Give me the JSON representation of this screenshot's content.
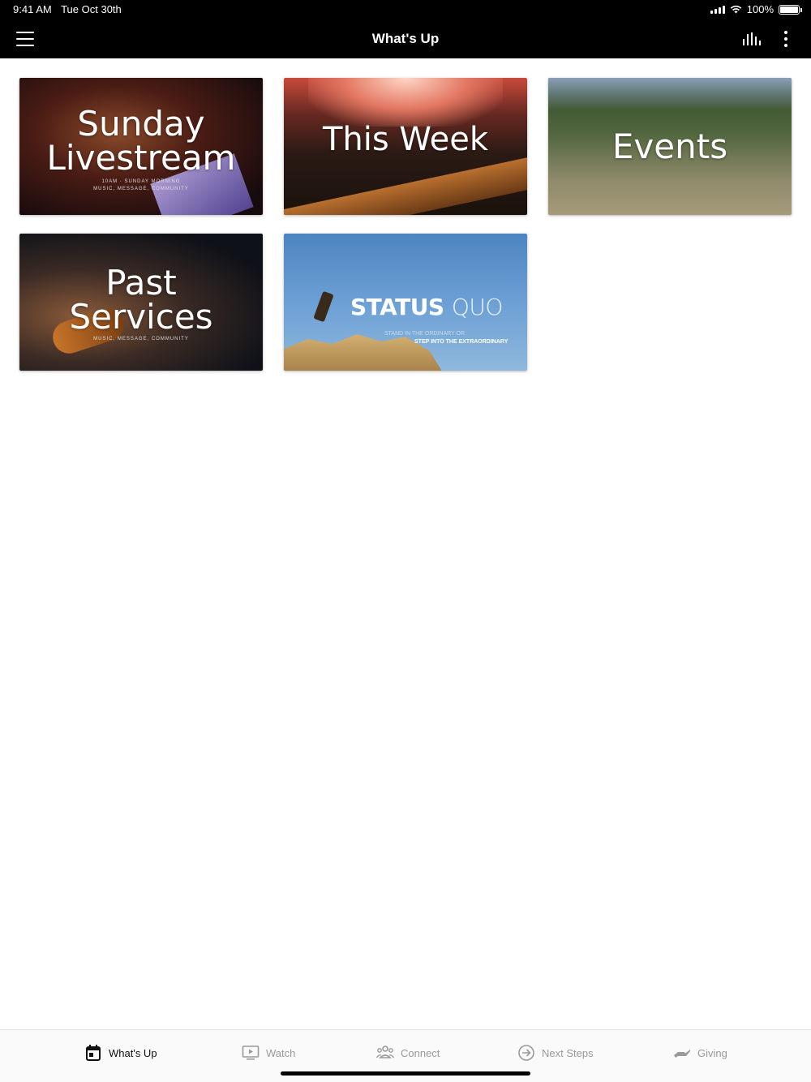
{
  "status_bar": {
    "time": "9:41 AM",
    "date": "Tue Oct 30th",
    "battery": "100%",
    "battery_level": 1.0
  },
  "header": {
    "title": "What's Up"
  },
  "tiles": [
    {
      "title_line1": "Sunday",
      "title_line2": "Livestream",
      "subtitle_line1": "10AM · SUNDAY MORNING",
      "subtitle_line2": "MUSIC, MESSAGE, COMMUNITY"
    },
    {
      "title": "This Week"
    },
    {
      "title": "Events"
    },
    {
      "title_line1": "Past",
      "title_line2": "Services",
      "subtitle": "MUSIC, MESSAGE, COMMUNITY"
    },
    {
      "title_bold": "STATUS",
      "title_light": "QUO",
      "line1": "STAND IN THE ORDINARY OR",
      "line2": "STEP INTO THE EXTRAORDINARY"
    }
  ],
  "tab_bar": {
    "tabs": [
      {
        "label": "What's Up",
        "icon": "calendar-icon",
        "active": true
      },
      {
        "label": "Watch",
        "icon": "tv-play-icon",
        "active": false
      },
      {
        "label": "Connect",
        "icon": "people-icon",
        "active": false
      },
      {
        "label": "Next Steps",
        "icon": "arrow-circle-icon",
        "active": false
      },
      {
        "label": "Giving",
        "icon": "hand-icon",
        "active": false
      }
    ]
  },
  "colors": {
    "header_bg": "#000000",
    "active_tab": "#111111",
    "inactive_tab": "#9a9a9a"
  }
}
